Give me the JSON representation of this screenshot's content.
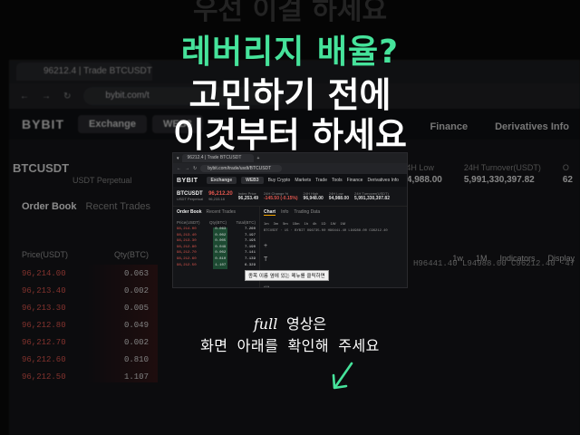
{
  "headline": {
    "line1": "레버리지 배율?",
    "line2": "고민하기 전에",
    "line3": "이것부터 하세요",
    "faded_top": "우선 이걸 하세요"
  },
  "background_browser": {
    "tab_title": "96212.4 | Trade BTCUSDT",
    "url": "bybit.com/t",
    "logo": "BYBIT",
    "exchange_pill": "Exchange",
    "web3_pill": "WEB3",
    "right_nav": [
      "Finance",
      "Derivatives Info"
    ],
    "pair": "BTCUSDT",
    "pair_sub": "USDT Perpetual",
    "stats": [
      {
        "label": "24H Low",
        "value": "94,988.00"
      },
      {
        "label": "24H Turnover(USDT)",
        "value": "5,991,330,397.82"
      },
      {
        "label": "O",
        "value": "62"
      }
    ],
    "orderbook_tabs": [
      "Order Book",
      "Recent Trades"
    ],
    "orderbook_head": [
      "Price(USDT)",
      "Qty(BTC)"
    ],
    "orderbook_rows": [
      {
        "price": "96,214.00",
        "qty": "0.063"
      },
      {
        "price": "96,213.40",
        "qty": "0.002"
      },
      {
        "price": "96,213.30",
        "qty": "0.005"
      },
      {
        "price": "96,212.80",
        "qty": "0.049"
      },
      {
        "price": "96,212.70",
        "qty": "0.002"
      },
      {
        "price": "96,212.60",
        "qty": "0.810"
      },
      {
        "price": "96,212.50",
        "qty": "1.107"
      }
    ],
    "chart_toolbar": [
      "1w",
      "1M",
      "Indicators",
      "Display"
    ],
    "chart_ohlc": "H96441.40  L94988.00  C96212.40  -47"
  },
  "inset": {
    "tab_title": "96212.4 | Trade BTCUSDT",
    "url": "bybit.com/trade/usdt/BTCUSDT",
    "logo": "BYBIT",
    "nav": [
      "Exchange",
      "WEB3",
      "Buy Crypto",
      "Markets",
      "Trade",
      "Tools",
      "Finance",
      "Derivatives Info"
    ],
    "pair": "BTCUSDT",
    "pair_sub": "USDT Perpetual",
    "price": "96,212.20",
    "price_sub": "96,233.18",
    "stats": [
      {
        "label": "Index Price",
        "value": "96,253.49"
      },
      {
        "label": "24H Change %",
        "value": "-145.50 (-0.15%)"
      },
      {
        "label": "24H High",
        "value": "96,948.00"
      },
      {
        "label": "24H Low",
        "value": "94,988.00"
      },
      {
        "label": "24H Turnover(USDT)",
        "value": "5,991,330,397.82"
      }
    ],
    "orderbook_tabs": [
      "Order Book",
      "Recent Trades"
    ],
    "orderbook_head": [
      "Price(USDT)",
      "Qty(BTC)",
      "Total(BTC)"
    ],
    "orderbook_rows": [
      {
        "price": "96,214.00",
        "qty": "0.063",
        "total": "7.260"
      },
      {
        "price": "96,213.40",
        "qty": "0.002",
        "total": "7.197"
      },
      {
        "price": "96,213.30",
        "qty": "0.005",
        "total": "7.195"
      },
      {
        "price": "96,212.80",
        "qty": "0.049",
        "total": "7.190"
      },
      {
        "price": "96,212.70",
        "qty": "0.002",
        "total": "7.141"
      },
      {
        "price": "96,212.60",
        "qty": "0.810",
        "total": "7.139"
      },
      {
        "price": "96,212.50",
        "qty": "1.107",
        "total": "6.329"
      }
    ],
    "chart_tabs": [
      "Chart",
      "Info",
      "Trading Data"
    ],
    "timeframes": [
      "1m",
      "3m",
      "5m",
      "15m",
      "1h",
      "4h",
      "1D",
      "1W",
      "1M"
    ],
    "chart_ohlc": "BTCUSDT · 15 · BYBIT  O96735.00 H96441.40 L94988.00 C96212.40",
    "tooltip": "종목 이름 옆에 있는 메뉴를 클릭하면"
  },
  "caption": {
    "line1_en": "full",
    "line1_ko": "영상은",
    "line2": "화면 아래를 확인해 주세요"
  },
  "colors": {
    "headline_accent": "#46e39b",
    "sell_red": "#e0564e",
    "arrow_green": "#46e39b"
  }
}
